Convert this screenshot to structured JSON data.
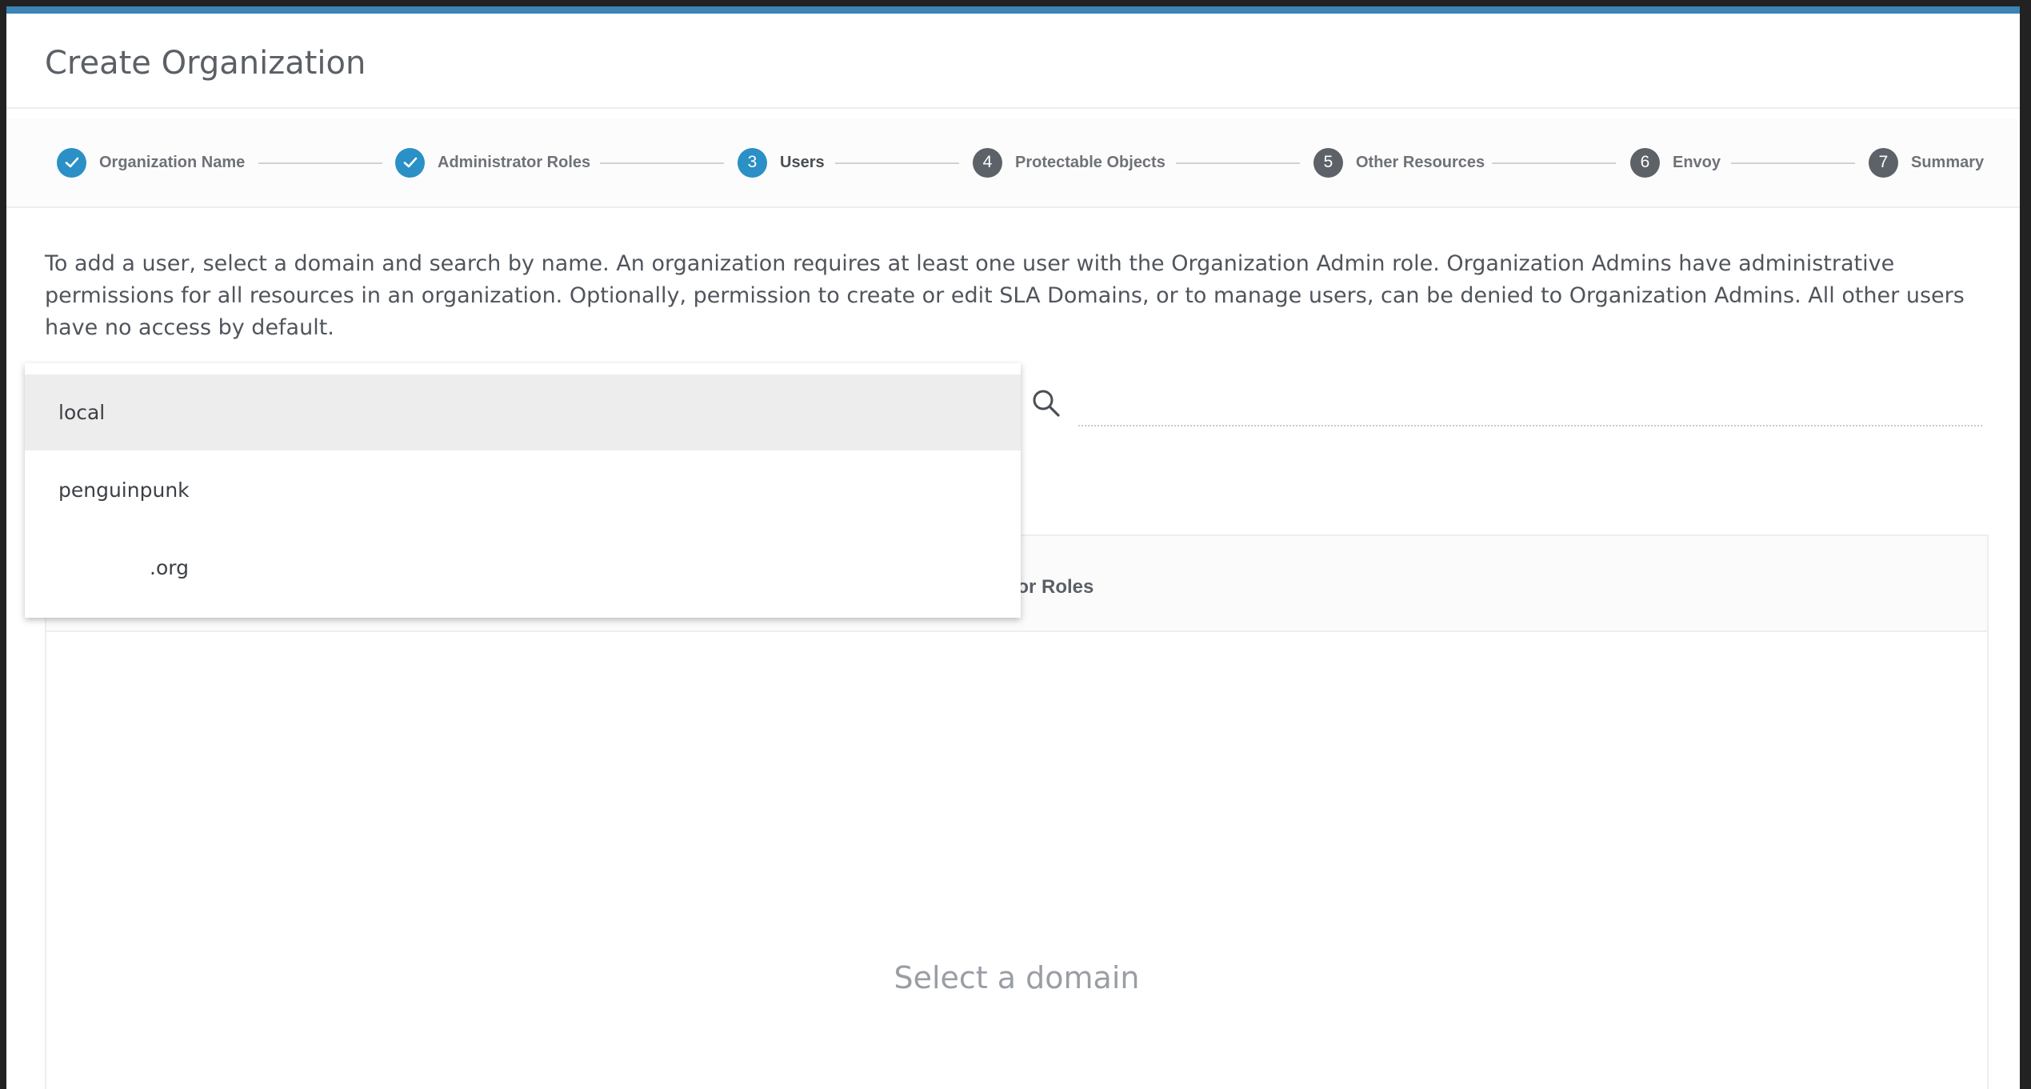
{
  "dialog": {
    "title": "Create Organization"
  },
  "steps": [
    {
      "number": "",
      "label": "Organization Name",
      "state": "done"
    },
    {
      "number": "",
      "label": "Administrator Roles",
      "state": "done"
    },
    {
      "number": "3",
      "label": "Users",
      "state": "current"
    },
    {
      "number": "4",
      "label": "Protectable Objects",
      "state": "todo"
    },
    {
      "number": "5",
      "label": "Other Resources",
      "state": "todo"
    },
    {
      "number": "6",
      "label": "Envoy",
      "state": "todo"
    },
    {
      "number": "7",
      "label": "Summary",
      "state": "todo"
    }
  ],
  "description": "To add a user, select a domain and search by name. An organization requires at least one user with the Organization Admin role. Organization Admins have administrative permissions for all resources in an organization. Optionally, permission to create or edit SLA Domains, or to manage users, can be denied to Organization Admins. All other users have no access by default.",
  "domain_dropdown": {
    "options": [
      "local",
      "penguinpunk",
      ".org"
    ],
    "highlighted_index": 0
  },
  "search": {
    "icon": "search-icon",
    "placeholder": ""
  },
  "table": {
    "header_visible_text": "ator Roles",
    "empty_message": "Select a domain"
  },
  "colors": {
    "accent": "#2a90c6",
    "topbar": "#3b84b5",
    "step_pending": "#5d6168"
  }
}
